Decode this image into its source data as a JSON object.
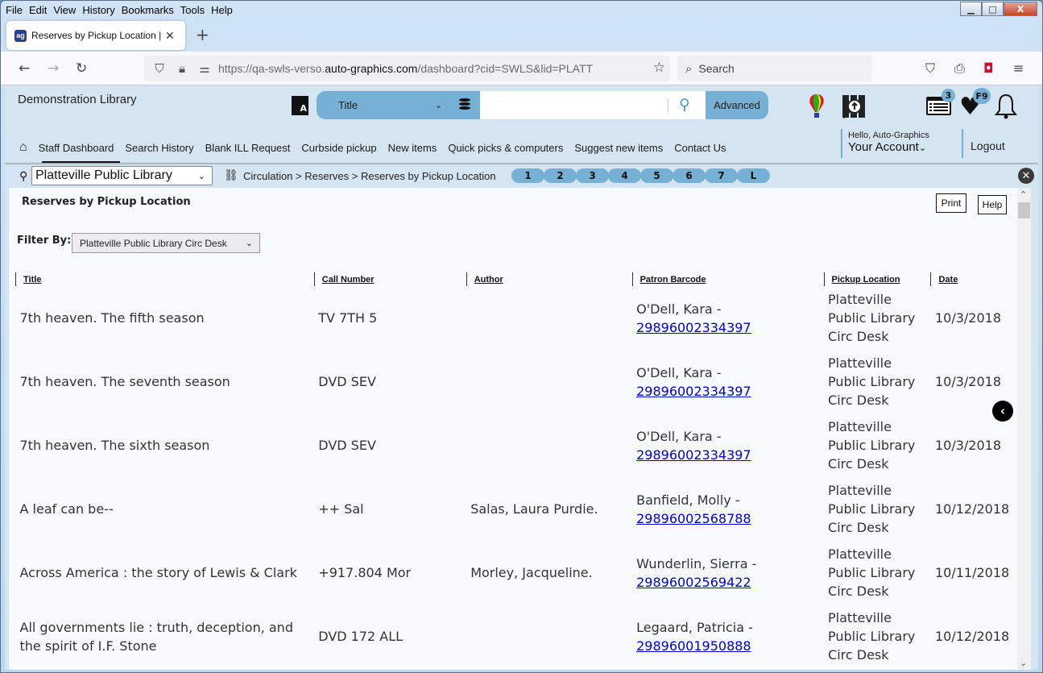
{
  "browser": {
    "menu": [
      "File",
      "Edit",
      "View",
      "History",
      "Bookmarks",
      "Tools",
      "Help"
    ],
    "tab_title": "Reserves by Pickup Location | SWLS",
    "url_prefix": "https://qa-swls-verso.",
    "url_domain": "auto-graphics.com",
    "url_path": "/dashboard?cid=SWLS&lid=PLATT",
    "search_placeholder": "Search",
    "window_controls": {
      "minimize": "▁",
      "maximize": "□",
      "close": "X"
    }
  },
  "header": {
    "library_name": "Demonstration Library",
    "search_scope": "Title",
    "search_value": "",
    "advanced_label": "Advanced",
    "list_badge": "3",
    "heart_badge": "F9"
  },
  "nav": {
    "items": [
      "Staff Dashboard",
      "Search History",
      "Blank ILL Request",
      "Curbside pickup",
      "New items",
      "Quick picks & computers",
      "Suggest new items",
      "Contact Us"
    ],
    "active": "Staff Dashboard",
    "greeting": "Hello, Auto-Graphics",
    "account_label": "Your Account",
    "logout_label": "Logout"
  },
  "location_bar": {
    "library_select": "Platteville Public Library",
    "breadcrumb": "Circulation > Reserves > Reserves by Pickup Location",
    "pills": [
      "1",
      "2",
      "3",
      "4",
      "5",
      "6",
      "7",
      "L"
    ]
  },
  "content": {
    "title": "Reserves by Pickup Location",
    "print_label": "Print",
    "help_label": "Help",
    "filter_label": "Filter By:",
    "filter_value": "Platteville Public Library Circ Desk",
    "columns": [
      "Title",
      "Call Number",
      "Author",
      "Patron Barcode",
      "Pickup Location",
      "Date"
    ],
    "rows": [
      {
        "title": "7th heaven. The fifth season",
        "call_number": "TV 7TH 5",
        "author": "",
        "patron": "O'Dell, Kara -",
        "barcode": "29896002334397",
        "pickup": "Platteville Public Library Circ Desk",
        "date": "10/3/2018"
      },
      {
        "title": "7th heaven. The seventh season",
        "call_number": "DVD SEV",
        "author": "",
        "patron": "O'Dell, Kara -",
        "barcode": "29896002334397",
        "pickup": "Platteville Public Library Circ Desk",
        "date": "10/3/2018"
      },
      {
        "title": "7th heaven. The sixth season",
        "call_number": "DVD SEV",
        "author": "",
        "patron": "O'Dell, Kara -",
        "barcode": "29896002334397",
        "pickup": "Platteville Public Library Circ Desk",
        "date": "10/3/2018"
      },
      {
        "title": "A leaf can be--",
        "call_number": "++ Sal",
        "author": "Salas, Laura Purdie.",
        "patron": "Banfield, Molly -",
        "barcode": "29896002568788",
        "pickup": "Platteville Public Library Circ Desk",
        "date": "10/12/2018"
      },
      {
        "title": "Across America : the story of Lewis & Clark",
        "call_number": "+917.804 Mor",
        "author": "Morley, Jacqueline.",
        "patron": "Wunderlin, Sierra -",
        "barcode": "29896002569422",
        "pickup": "Platteville Public Library Circ Desk",
        "date": "10/11/2018"
      },
      {
        "title": "All governments lie : truth, deception, and the spirit of I.F. Stone",
        "call_number": "DVD 172 ALL",
        "author": "",
        "patron": "Legaard, Patricia -",
        "barcode": "29896001950888",
        "pickup": "Platteville Public Library Circ Desk",
        "date": "10/12/2018"
      }
    ]
  },
  "colors": {
    "accent": "#76b1d5",
    "page_bg": "#d4e5f1",
    "link": "#0000cc"
  }
}
